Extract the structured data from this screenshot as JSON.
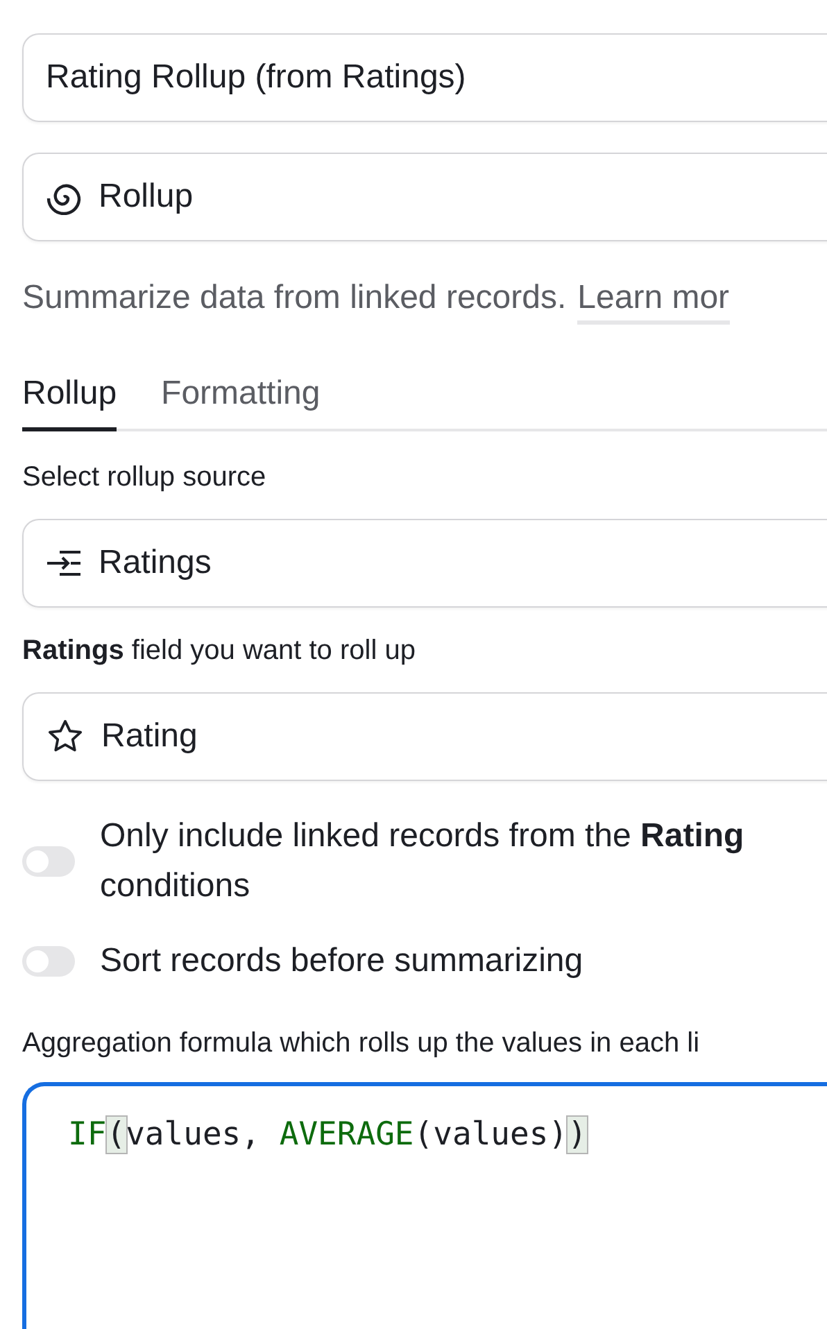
{
  "name_field": {
    "value": "Rating Rollup (from Ratings)"
  },
  "type_field": {
    "value": "Rollup"
  },
  "description": {
    "text": "Summarize data from linked records.",
    "link": "Learn mor"
  },
  "tabs": [
    {
      "label": "Rollup",
      "selected": true
    },
    {
      "label": "Formatting",
      "selected": false
    }
  ],
  "source": {
    "label": "Select rollup source",
    "value": "Ratings"
  },
  "field": {
    "label": "**Ratings** field you want to roll up",
    "value": "Rating"
  },
  "options": [
    {
      "label": "Only include linked records from the **Rating**\nconditions",
      "on": false
    },
    {
      "label": "Sort records before summarizing",
      "on": false
    }
  ],
  "formula": {
    "label": "Aggregation formula which rolls up the values in each li",
    "focused": true,
    "tokens": [
      {
        "text": "IF",
        "kind": "function"
      },
      {
        "text": "(",
        "kind": "bracket"
      },
      {
        "text": "values, ",
        "kind": "plain"
      },
      {
        "text": "AVERAGE",
        "kind": "function"
      },
      {
        "text": "(values)",
        "kind": "plain"
      },
      {
        "text": ")",
        "kind": "bracket"
      }
    ]
  }
}
